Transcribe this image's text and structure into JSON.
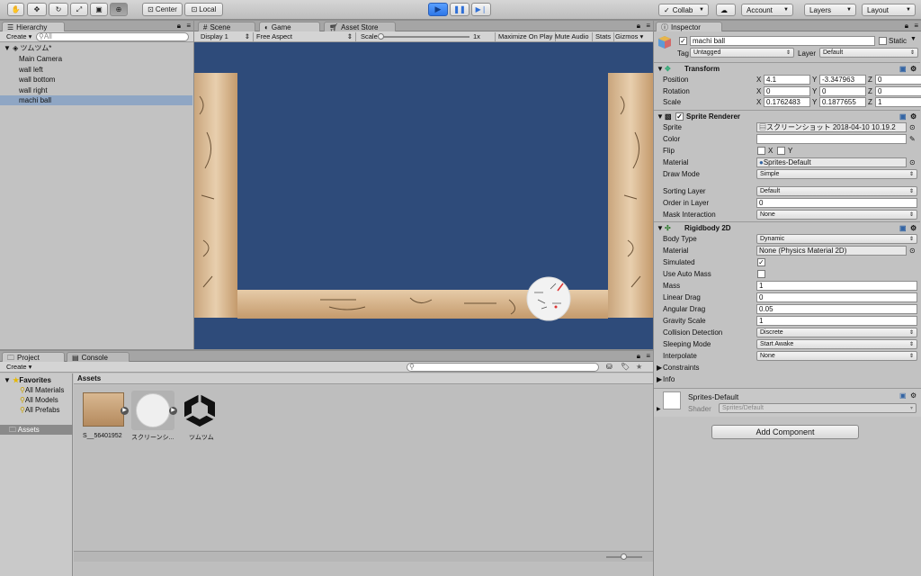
{
  "toolbar": {
    "pivot_label": "Center",
    "space_label": "Local",
    "collab_label": "Collab",
    "account_label": "Account",
    "layers_label": "Layers",
    "layout_label": "Layout"
  },
  "hierarchy": {
    "tab": "Hierarchy",
    "create_label": "Create",
    "search_placeholder": "All",
    "scene_name": "ツムツム*",
    "items": [
      {
        "label": "Main Camera",
        "selected": false
      },
      {
        "label": "wall left",
        "selected": false
      },
      {
        "label": "wall bottom",
        "selected": false
      },
      {
        "label": "wall right",
        "selected": false
      },
      {
        "label": "machi ball",
        "selected": true
      }
    ]
  },
  "game_view": {
    "tabs": [
      "Scene",
      "Game",
      "Asset Store"
    ],
    "display": "Display 1",
    "aspect": "Free Aspect",
    "scale_label": "Scale",
    "scale_value": "1x",
    "maximize": "Maximize On Play",
    "mute": "Mute Audio",
    "stats": "Stats",
    "gizmos": "Gizmos",
    "bg_color": "#2e4b7a"
  },
  "project": {
    "tabs": [
      "Project",
      "Console"
    ],
    "create_label": "Create",
    "favorites_label": "Favorites",
    "favorites": [
      "All Materials",
      "All Models",
      "All Prefabs"
    ],
    "assets_root": "Assets",
    "breadcrumb": "Assets",
    "assets": [
      {
        "name": "S__56401952",
        "icon": "sprite-thumbnail"
      },
      {
        "name": "スクリーンシ...",
        "icon": "sprite-thumbnail"
      },
      {
        "name": "ツムツム",
        "icon": "unity-scene-icon"
      }
    ]
  },
  "inspector": {
    "tab": "Inspector",
    "object_name": "machi ball",
    "static_label": "Static",
    "tag_label": "Tag",
    "tag_value": "Untagged",
    "layer_label": "Layer",
    "layer_value": "Default",
    "transform": {
      "title": "Transform",
      "position_label": "Position",
      "rotation_label": "Rotation",
      "scale_label": "Scale",
      "position": {
        "x": "4.1",
        "y": "-3.347963",
        "z": "0"
      },
      "rotation": {
        "x": "0",
        "y": "0",
        "z": "0"
      },
      "scale": {
        "x": "0.1762483",
        "y": "0.1877655",
        "z": "1"
      }
    },
    "sprite_renderer": {
      "title": "Sprite Renderer",
      "sprite_label": "Sprite",
      "sprite_value": "スクリーンショット 2018-04-10 10.19.2",
      "color_label": "Color",
      "flip_label": "Flip",
      "flip_x": "X",
      "flip_y": "Y",
      "material_label": "Material",
      "material_value": "Sprites-Default",
      "draw_mode_label": "Draw Mode",
      "draw_mode_value": "Simple",
      "sorting_layer_label": "Sorting Layer",
      "sorting_layer_value": "Default",
      "order_label": "Order in Layer",
      "order_value": "0",
      "mask_label": "Mask Interaction",
      "mask_value": "None"
    },
    "rigidbody": {
      "title": "Rigidbody 2D",
      "body_type_label": "Body Type",
      "body_type_value": "Dynamic",
      "material_label": "Material",
      "material_value": "None (Physics Material 2D)",
      "simulated_label": "Simulated",
      "auto_mass_label": "Use Auto Mass",
      "mass_label": "Mass",
      "mass_value": "1",
      "linear_drag_label": "Linear Drag",
      "linear_drag_value": "0",
      "angular_drag_label": "Angular Drag",
      "angular_drag_value": "0.05",
      "gravity_label": "Gravity Scale",
      "gravity_value": "1",
      "collision_label": "Collision Detection",
      "collision_value": "Discrete",
      "sleeping_label": "Sleeping Mode",
      "sleeping_value": "Start Awake",
      "interpolate_label": "Interpolate",
      "interpolate_value": "None",
      "constraints_label": "Constraints",
      "info_label": "Info"
    },
    "material_asset": {
      "name": "Sprites-Default",
      "shader_label": "Shader",
      "shader_value": "Sprites/Default"
    },
    "add_component_label": "Add Component"
  }
}
